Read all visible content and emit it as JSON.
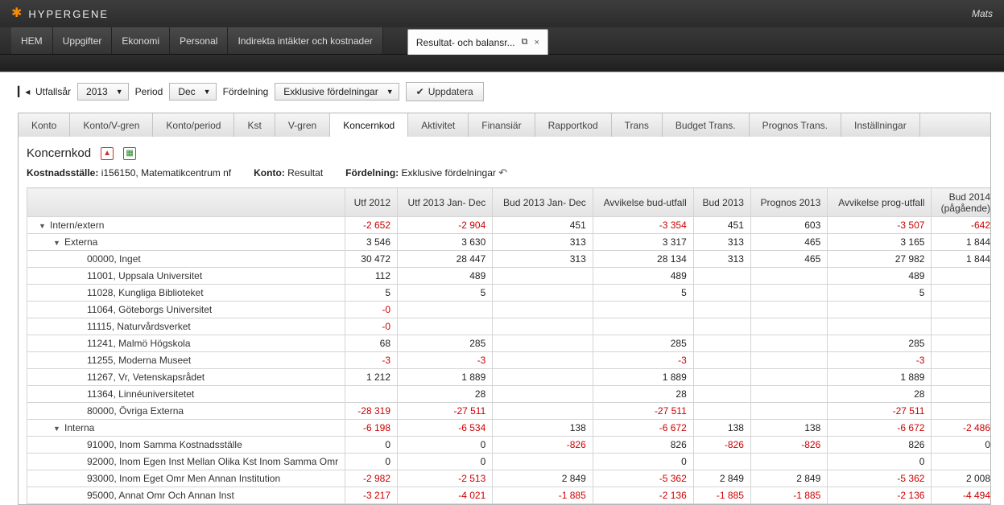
{
  "brand": "HYPERGENE",
  "user": "Mats",
  "menu": [
    "HEM",
    "Uppgifter",
    "Ekonomi",
    "Personal",
    "Indirekta intäkter och kostnader"
  ],
  "docTab": "Resultat- och balansr...",
  "toolbar": {
    "utfallsar": {
      "label": "Utfallsår",
      "value": "2013"
    },
    "period": {
      "label": "Period",
      "value": "Dec"
    },
    "fordelning": {
      "label": "Fördelning",
      "value": "Exklusive fördelningar"
    },
    "update": "Uppdatera"
  },
  "subtabs": [
    "Konto",
    "Konto/V-gren",
    "Konto/period",
    "Kst",
    "V-gren",
    "Koncernkod",
    "Aktivitet",
    "Finansiär",
    "Rapportkod",
    "Trans",
    "Budget Trans.",
    "Prognos Trans.",
    "Inställningar"
  ],
  "activeTab": "Koncernkod",
  "title": "Koncernkod",
  "meta": {
    "ks_label": "Kostnadsställe:",
    "ks_val": "i156150, Matematikcentrum nf",
    "konto_label": "Konto:",
    "konto_val": "Resultat",
    "ford_label": "Fördelning:",
    "ford_val": "Exklusive fördelningar"
  },
  "columns": [
    "",
    "Utf 2012",
    "Utf 2013 Jan- Dec",
    "Bud 2013 Jan- Dec",
    "Avvikelse bud-utfall",
    "Bud 2013",
    "Prognos 2013",
    "Avvikelse prog-utfall",
    "Bud 2014 (pågående)"
  ],
  "rows": [
    {
      "l": 0,
      "t": "▼",
      "label": "Intern/extern",
      "v": [
        "-2 652",
        "-2 904",
        "451",
        "-3 354",
        "451",
        "603",
        "-3 507",
        "-642"
      ]
    },
    {
      "l": 1,
      "t": "▼",
      "label": "Externa",
      "v": [
        "3 546",
        "3 630",
        "313",
        "3 317",
        "313",
        "465",
        "3 165",
        "1 844"
      ]
    },
    {
      "l": 2,
      "t": "",
      "label": "00000, Inget",
      "v": [
        "30 472",
        "28 447",
        "313",
        "28 134",
        "313",
        "465",
        "27 982",
        "1 844"
      ]
    },
    {
      "l": 2,
      "t": "",
      "label": "11001, Uppsala Universitet",
      "v": [
        "112",
        "489",
        "",
        "489",
        "",
        "",
        "489",
        ""
      ]
    },
    {
      "l": 2,
      "t": "",
      "label": "11028, Kungliga Biblioteket",
      "v": [
        "5",
        "5",
        "",
        "5",
        "",
        "",
        "5",
        ""
      ]
    },
    {
      "l": 2,
      "t": "",
      "label": "11064, Göteborgs Universitet",
      "v": [
        "-0",
        "",
        "",
        "",
        "",
        "",
        "",
        ""
      ]
    },
    {
      "l": 2,
      "t": "",
      "label": "11115, Naturvårdsverket",
      "v": [
        "-0",
        "",
        "",
        "",
        "",
        "",
        "",
        ""
      ]
    },
    {
      "l": 2,
      "t": "",
      "label": "11241, Malmö Högskola",
      "v": [
        "68",
        "285",
        "",
        "285",
        "",
        "",
        "285",
        ""
      ]
    },
    {
      "l": 2,
      "t": "",
      "label": "11255, Moderna Museet",
      "v": [
        "-3",
        "-3",
        "",
        "-3",
        "",
        "",
        "-3",
        ""
      ]
    },
    {
      "l": 2,
      "t": "",
      "label": "11267, Vr, Vetenskapsrådet",
      "v": [
        "1 212",
        "1 889",
        "",
        "1 889",
        "",
        "",
        "1 889",
        ""
      ]
    },
    {
      "l": 2,
      "t": "",
      "label": "11364, Linnéuniversitetet",
      "v": [
        "",
        "28",
        "",
        "28",
        "",
        "",
        "28",
        ""
      ]
    },
    {
      "l": 2,
      "t": "",
      "label": "80000, Övriga Externa",
      "v": [
        "-28 319",
        "-27 511",
        "",
        "-27 511",
        "",
        "",
        "-27 511",
        ""
      ]
    },
    {
      "l": 1,
      "t": "▼",
      "label": "Interna",
      "v": [
        "-6 198",
        "-6 534",
        "138",
        "-6 672",
        "138",
        "138",
        "-6 672",
        "-2 486"
      ]
    },
    {
      "l": 2,
      "t": "",
      "label": "91000, Inom Samma Kostnadsställe",
      "v": [
        "0",
        "0",
        "-826",
        "826",
        "-826",
        "-826",
        "826",
        "0"
      ]
    },
    {
      "l": 2,
      "t": "",
      "label": "92000, Inom Egen Inst Mellan Olika Kst Inom Samma Omr",
      "v": [
        "0",
        "0",
        "",
        "0",
        "",
        "",
        "0",
        ""
      ]
    },
    {
      "l": 2,
      "t": "",
      "label": "93000, Inom Eget Omr Men Annan Institution",
      "v": [
        "-2 982",
        "-2 513",
        "2 849",
        "-5 362",
        "2 849",
        "2 849",
        "-5 362",
        "2 008"
      ]
    },
    {
      "l": 2,
      "t": "",
      "label": "95000, Annat Omr Och Annan Inst",
      "v": [
        "-3 217",
        "-4 021",
        "-1 885",
        "-2 136",
        "-1 885",
        "-1 885",
        "-2 136",
        "-4 494"
      ]
    }
  ]
}
